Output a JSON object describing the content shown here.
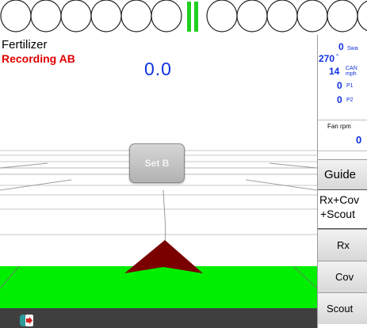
{
  "title": "Fertilizer",
  "recording_status": "Recording AB",
  "readout": "0.0",
  "set_b_label": "Set B",
  "stats": {
    "swath": {
      "value": "0",
      "unit": "Swa"
    },
    "heading": {
      "value": "270",
      "unit": "°"
    },
    "speed": {
      "value": "14",
      "unit_top": "CAN",
      "unit_bottom": "mph"
    },
    "p1": {
      "value": "0",
      "unit": "P1"
    },
    "p2": {
      "value": "0",
      "unit": "P2"
    }
  },
  "fan": {
    "label": "Fan rpm",
    "value": "0"
  },
  "guide_label": "Guide",
  "layer_button": {
    "line1": "Rx+Cov",
    "line2": "+Scout"
  },
  "layer_options": [
    "Rx",
    "Cov",
    "Scout"
  ],
  "colors": {
    "recording": "#e00000",
    "value_text": "#1030e0",
    "active_section": "#1fd01f",
    "field_green": "#00ee00",
    "vehicle": "#7a0000",
    "bottom_bar": "#3f3f3f"
  },
  "icons": [
    "section-indicator-icon",
    "vehicle-arrow-icon",
    "exit-icon"
  ]
}
